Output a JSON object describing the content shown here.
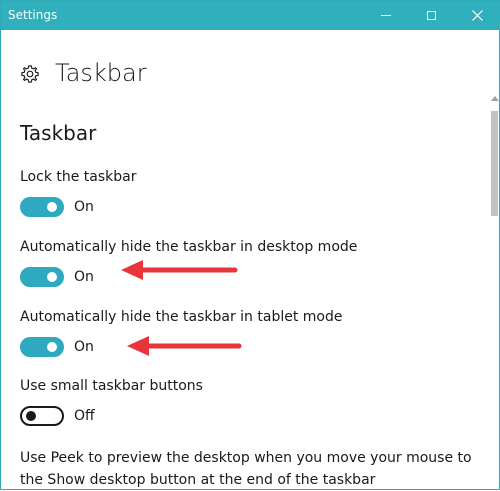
{
  "window": {
    "title": "Settings",
    "controls": {
      "minimize": "minimize-icon",
      "maximize": "maximize-icon",
      "close": "close-icon"
    },
    "accent": "#2fb0bc"
  },
  "header": {
    "icon": "gear-icon",
    "title": "Taskbar"
  },
  "section": {
    "title": "Taskbar"
  },
  "settings": [
    {
      "label": "Lock the taskbar",
      "state": "On",
      "on": true
    },
    {
      "label": "Automatically hide the taskbar in desktop mode",
      "state": "On",
      "on": true
    },
    {
      "label": "Automatically hide the taskbar in tablet mode",
      "state": "On",
      "on": true
    },
    {
      "label": "Use small taskbar buttons",
      "state": "Off",
      "on": false
    }
  ],
  "peek": {
    "label": "Use Peek to preview the desktop when you move your mouse to the Show desktop button at the end of the taskbar"
  },
  "colors": {
    "toggle_on": "#2fa9c0",
    "annotation_arrow": "#e8353b"
  }
}
